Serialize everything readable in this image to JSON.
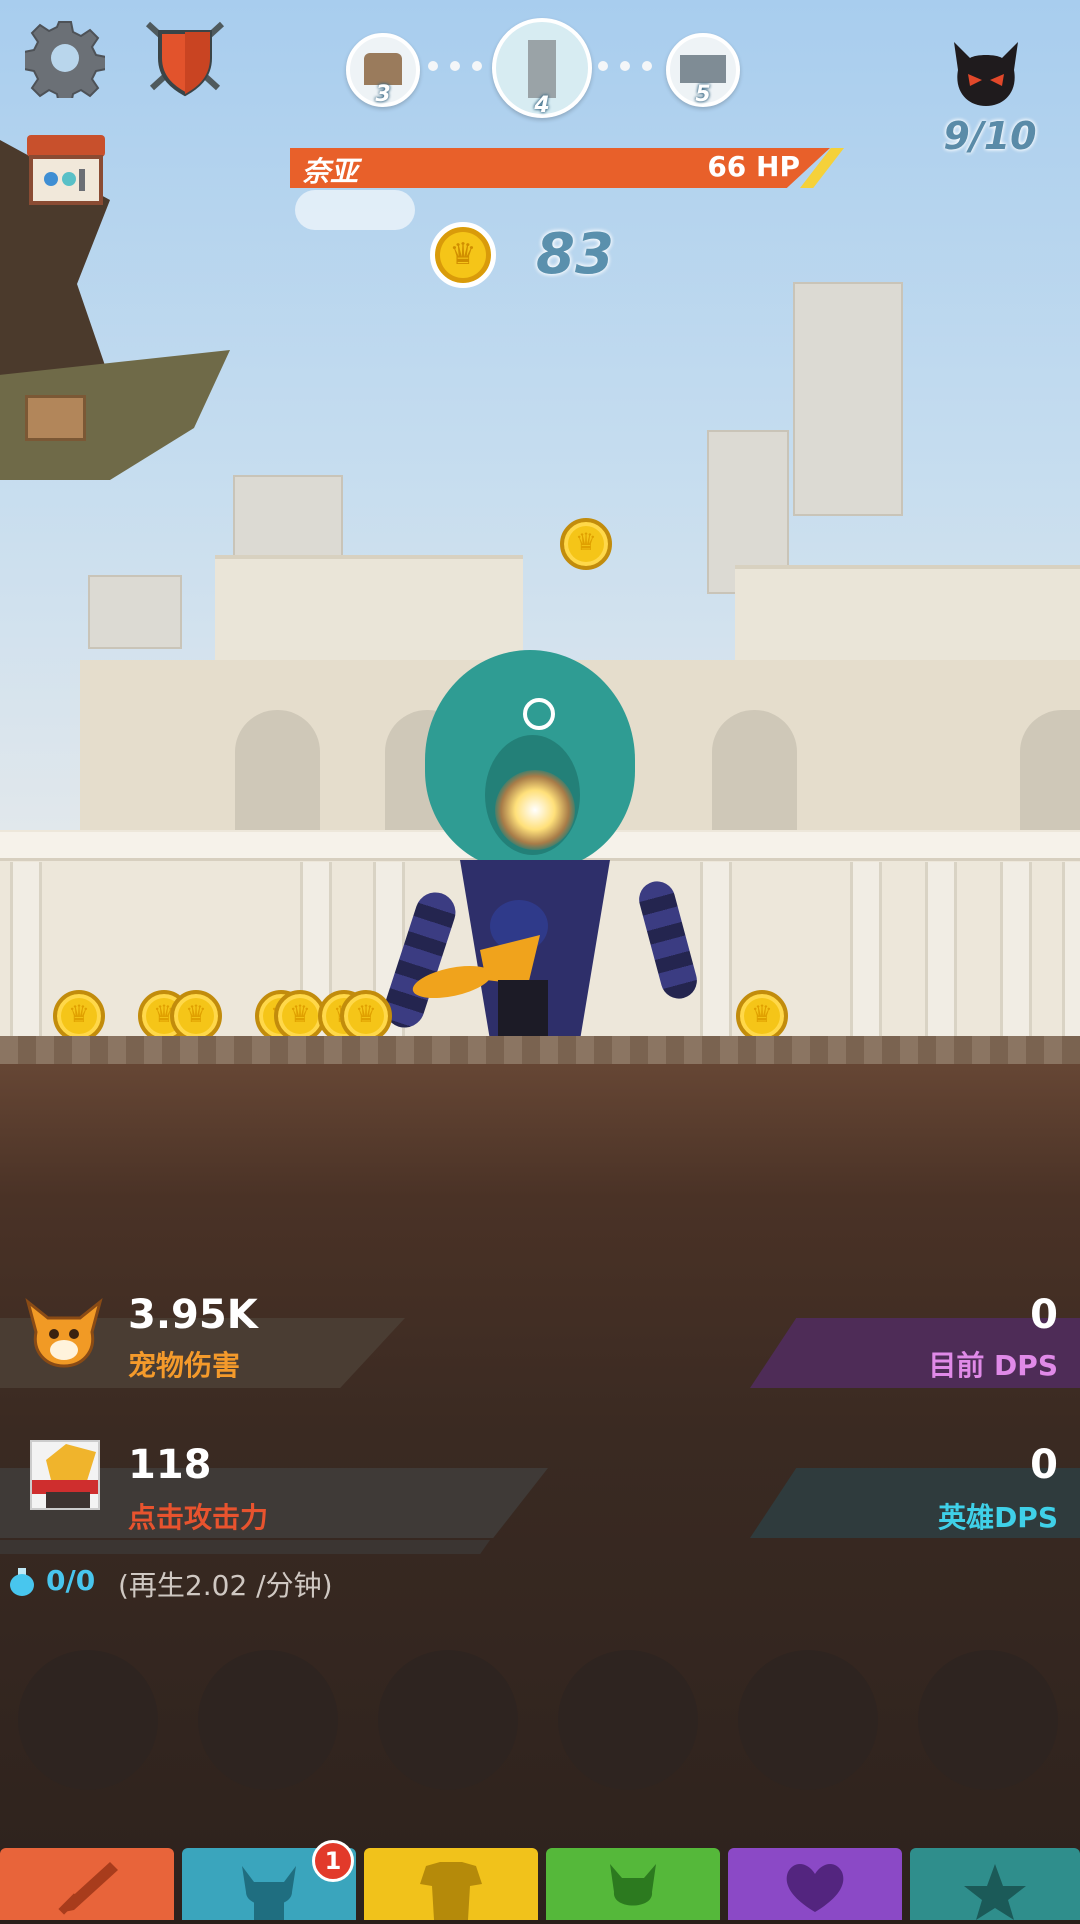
{
  "hud": {
    "stages": [
      {
        "number": "3",
        "current": false
      },
      {
        "number": "4",
        "current": true
      },
      {
        "number": "5",
        "current": false
      }
    ],
    "boss_counter": "9/10",
    "boss_name": "奈亚",
    "boss_hp": "66 HP",
    "gold": "83"
  },
  "stats": {
    "pet_damage_value": "3.95K",
    "pet_damage_label": "宠物伤害",
    "current_dps_value": "0",
    "current_dps_label": "目前 DPS",
    "tap_damage_value": "118",
    "tap_damage_label": "点击攻击力",
    "hero_dps_value": "0",
    "hero_dps_label": "英雄DPS"
  },
  "mana": {
    "value": "0/0",
    "regen": "(再生2.02 /分钟)"
  },
  "tabs": [
    {
      "name": "sword",
      "color": "#e8643a"
    },
    {
      "name": "heroes",
      "color": "#3aa5bd",
      "badge": "1"
    },
    {
      "name": "equipment",
      "color": "#f1c21b"
    },
    {
      "name": "pets",
      "color": "#55b83a"
    },
    {
      "name": "clan",
      "color": "#8b49c6"
    },
    {
      "name": "shop",
      "color": "#2f8e8c"
    }
  ],
  "icons": {
    "settings": "gear-icon",
    "clan_shield": "shield-swords-icon",
    "shop_stall": "shop-stall-icon",
    "boss": "devil-icon",
    "gold": "crown-coin-icon"
  },
  "colors": {
    "hp_bar": "#e8602a",
    "pet_label": "#f49a2b",
    "dps_label": "#e08ae8",
    "tap_label": "#e8532e",
    "hero_dps_label": "#3fd0e8",
    "mana": "#48c6ee"
  }
}
